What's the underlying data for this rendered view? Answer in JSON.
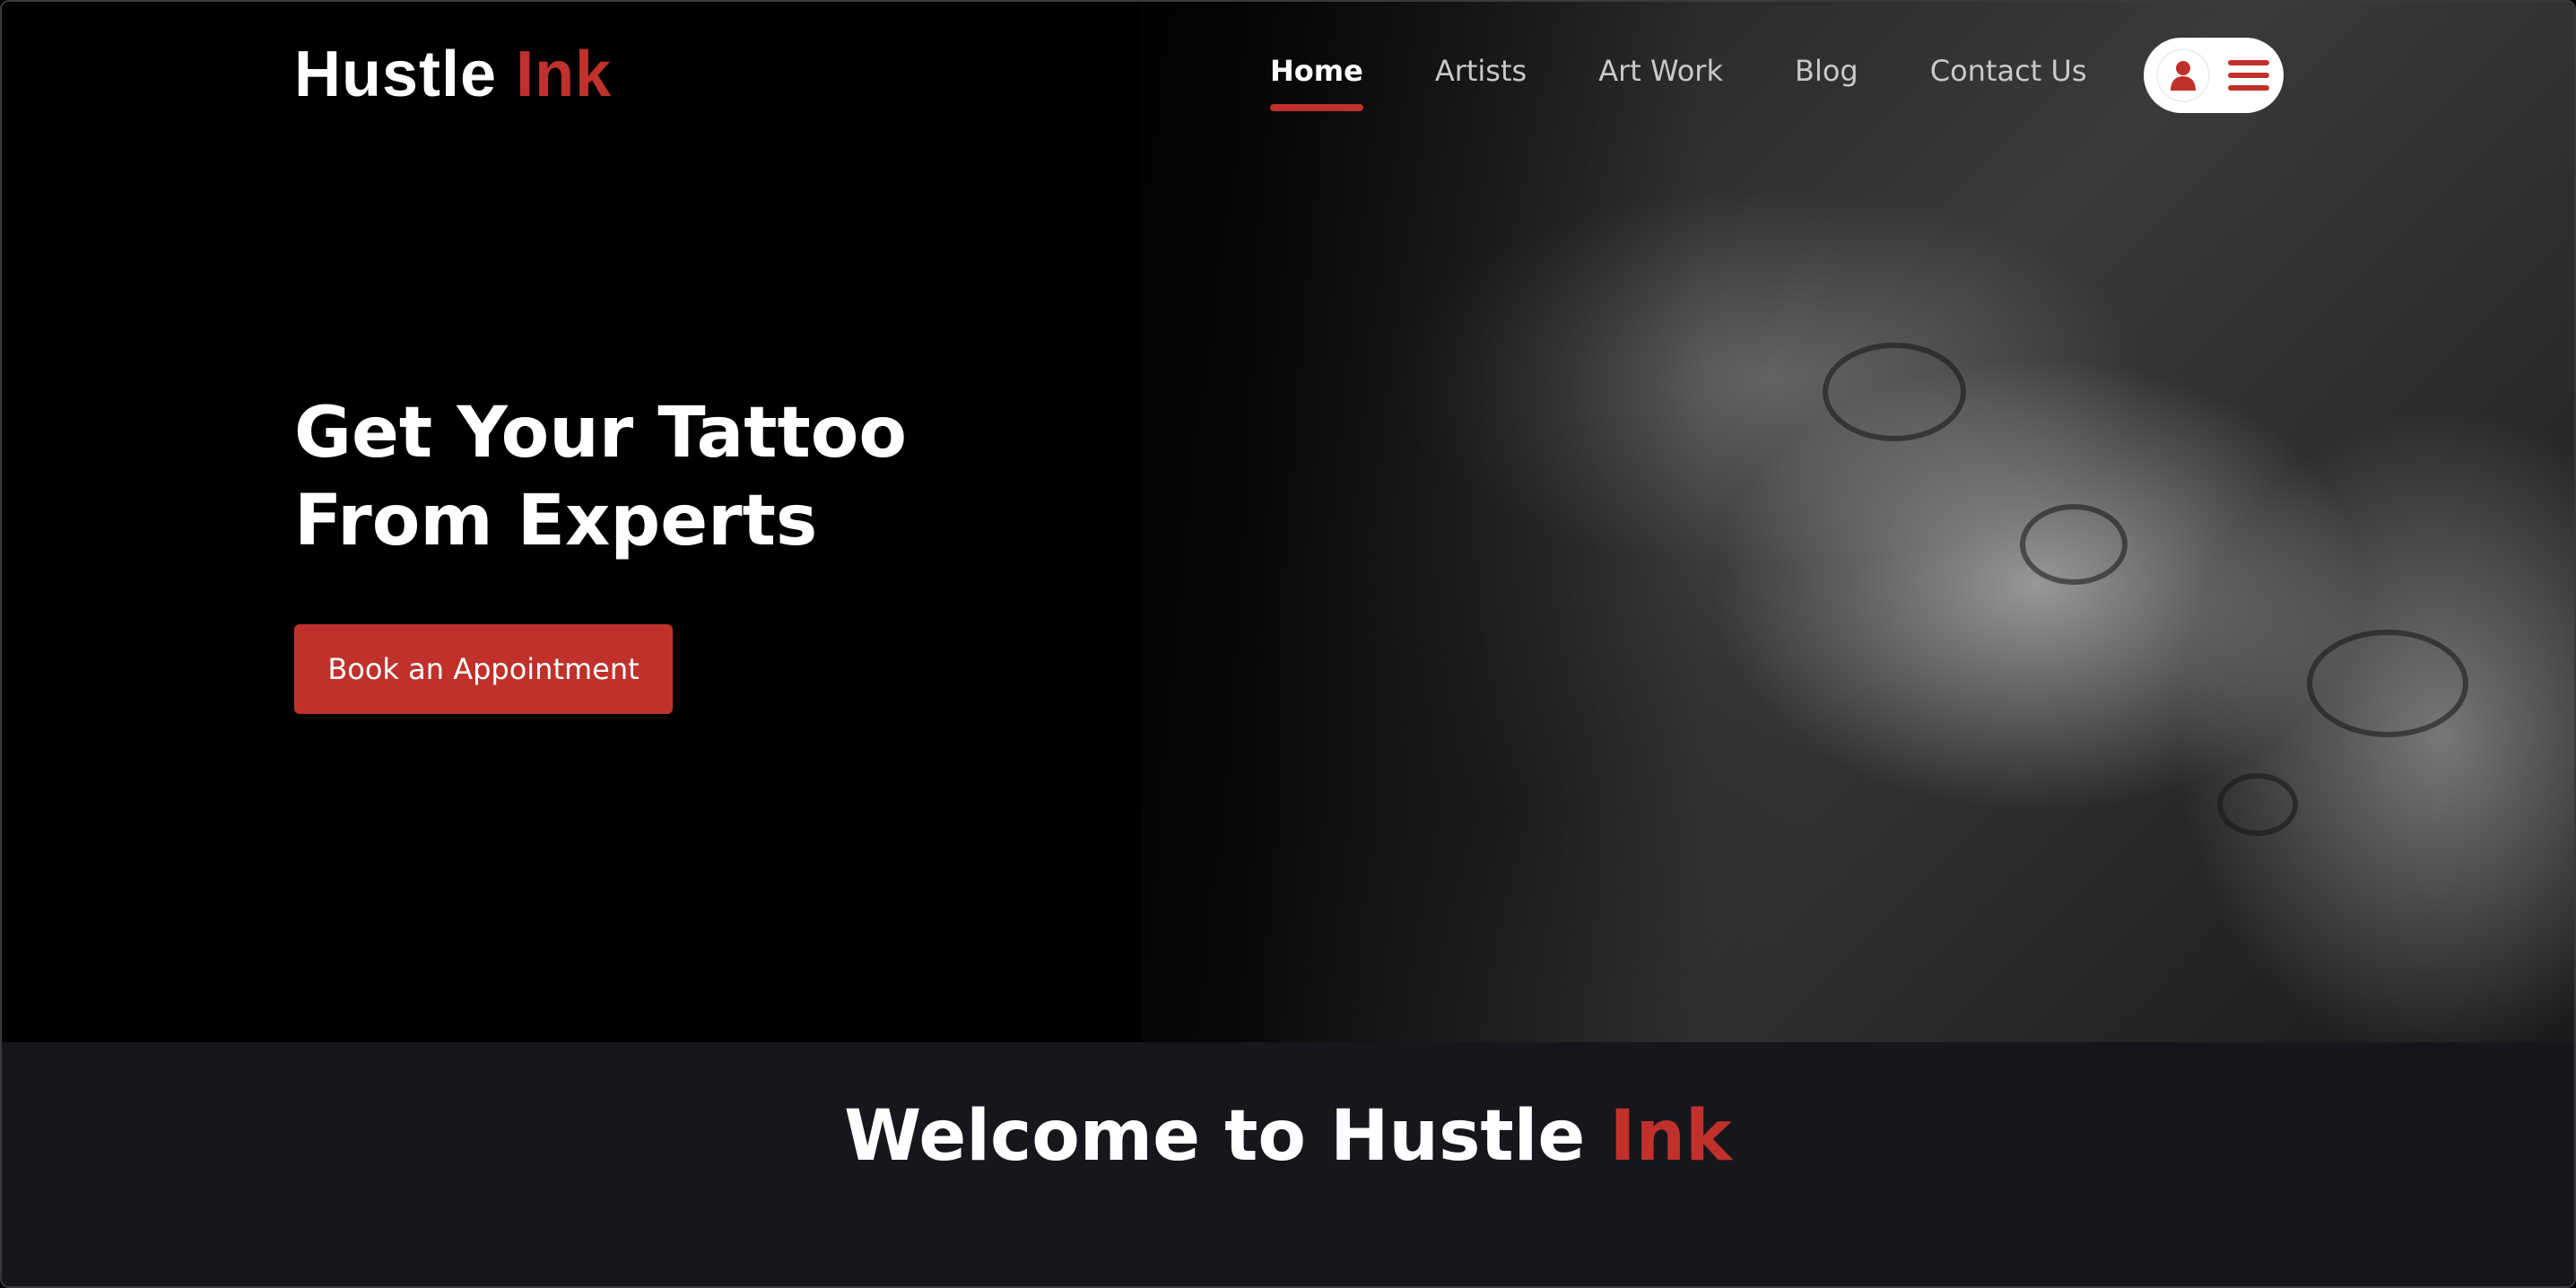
{
  "brand": {
    "name": "Hustle",
    "accent": "Ink",
    "accent_color": "#c0312b"
  },
  "nav": {
    "items": [
      {
        "label": "Home",
        "active": true
      },
      {
        "label": "Artists",
        "active": false
      },
      {
        "label": "Art Work",
        "active": false
      },
      {
        "label": "Blog",
        "active": false
      },
      {
        "label": "Contact Us",
        "active": false
      }
    ],
    "account_icon": "user-icon",
    "menu_icon": "hamburger-menu-icon"
  },
  "hero": {
    "title_line1": "Get Your Tattoo",
    "title_line2": "From Experts",
    "cta_label": "Book an Appointment",
    "background_image": "tattoo-artist-at-work-photo"
  },
  "welcome": {
    "title_prefix": "Welcome to Hustle",
    "title_accent": "Ink"
  },
  "colors": {
    "accent": "#c0312b",
    "hero_bg": "#000000",
    "section_bg": "#16161d",
    "text": "#ffffff",
    "nav_text": "#c9c9c9"
  }
}
